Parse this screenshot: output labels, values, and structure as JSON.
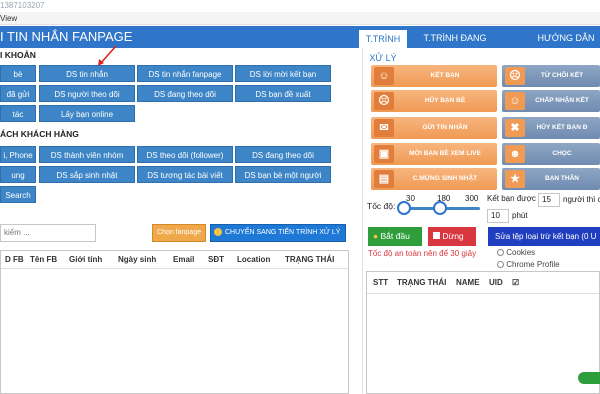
{
  "titlebar": {
    "text": "1387103207"
  },
  "menubar": {
    "view": "View"
  },
  "app": {
    "title": "I TIN NHẮN FANPAGE"
  },
  "tabs": [
    {
      "label": "T.TRÌNH XỬ LÝ"
    },
    {
      "label": "T.TRÌNH ĐANG CHẠY"
    },
    {
      "label": "HƯỚNG DẪN"
    }
  ],
  "sections": {
    "account": "I KHOẢN",
    "customers": "ÁCH KHÁCH HÀNG"
  },
  "account_buttons": [
    "bè",
    "DS tin nhắn",
    "DS tin nhắn fanpage",
    "DS lời mời kết bạn",
    "đã gửi",
    "DS người theo dõi",
    "DS đang theo dõi",
    "DS bạn đề xuất",
    "tác",
    "Lấy bạn online"
  ],
  "customer_buttons": [
    "i, Phone",
    "DS thành viên nhóm",
    "DS theo dõi (follower)",
    "DS đang theo dõi",
    "ung",
    "DS sắp sinh nhật",
    "DS tương tác bài viết",
    "DS bạn bè một người",
    "Search"
  ],
  "feature_buttons_left": [
    {
      "label": "KẾT BẠN",
      "icon": "add-friend-icon"
    },
    {
      "label": "HỦY BẠN BÈ",
      "icon": "remove-friend-icon"
    },
    {
      "label": "GỬI TIN NHẮN",
      "icon": "mail-icon"
    },
    {
      "label": "MỜI BẠN BÈ XEM LIVE",
      "icon": "live-icon"
    },
    {
      "label": "C.MỪNG SINH NHẬT",
      "icon": "birthday-icon"
    }
  ],
  "feature_buttons_right": [
    {
      "label": "TỪ CHỐI KẾT",
      "icon": "reject-icon"
    },
    {
      "label": "CHẤP NHẬN KẾT",
      "icon": "accept-icon"
    },
    {
      "label": "HỦY KẾT BẠN Đ",
      "icon": "cancel-request-icon"
    },
    {
      "label": "CHỌC",
      "icon": "poke-icon"
    },
    {
      "label": "BẠN THÂN",
      "icon": "star-icon"
    }
  ],
  "search": {
    "placeholder": "kiếm ..."
  },
  "choose_fanpage": "Chọn fanpage",
  "move_to_process": "CHUYỂN SANG TIẾN TRÌNH XỬ LÝ",
  "left_grid_columns": [
    "D FB",
    "Tên FB",
    "Giới tính",
    "Ngày sinh",
    "Email",
    "SĐT",
    "Location",
    "TRẠNG THÁI"
  ],
  "speed": {
    "label": "Tốc độ:",
    "ticks": [
      "30",
      "180",
      "300"
    ],
    "handle1": 0.0,
    "handle2": 0.5,
    "friend_label": "Kết bạn được",
    "friend_value": "15",
    "after_label": "người thì c",
    "minutes_value": "10",
    "minutes_label": "phút"
  },
  "controls": {
    "start": "Bắt đầu",
    "stop": "Dừng",
    "edit_exclusion": "Sửa tệp loại trừ kết bạn (0 U",
    "safe_speed": "Tốc độ an toàn nên để 30 giây",
    "cookies": "Cookies",
    "chrome_profile": "Chrome Profile"
  },
  "right_grid_columns": [
    "STT",
    "TRẠNG THÁI",
    "NAME",
    "UID",
    "☑"
  ],
  "colors": {
    "header": "#2f75c9",
    "blue_button": "#3d85c6",
    "orange_button": "#f09a54",
    "start_green": "#2e9e3a",
    "stop_red": "#d9373f",
    "edit_blue": "#1f3fc0"
  }
}
